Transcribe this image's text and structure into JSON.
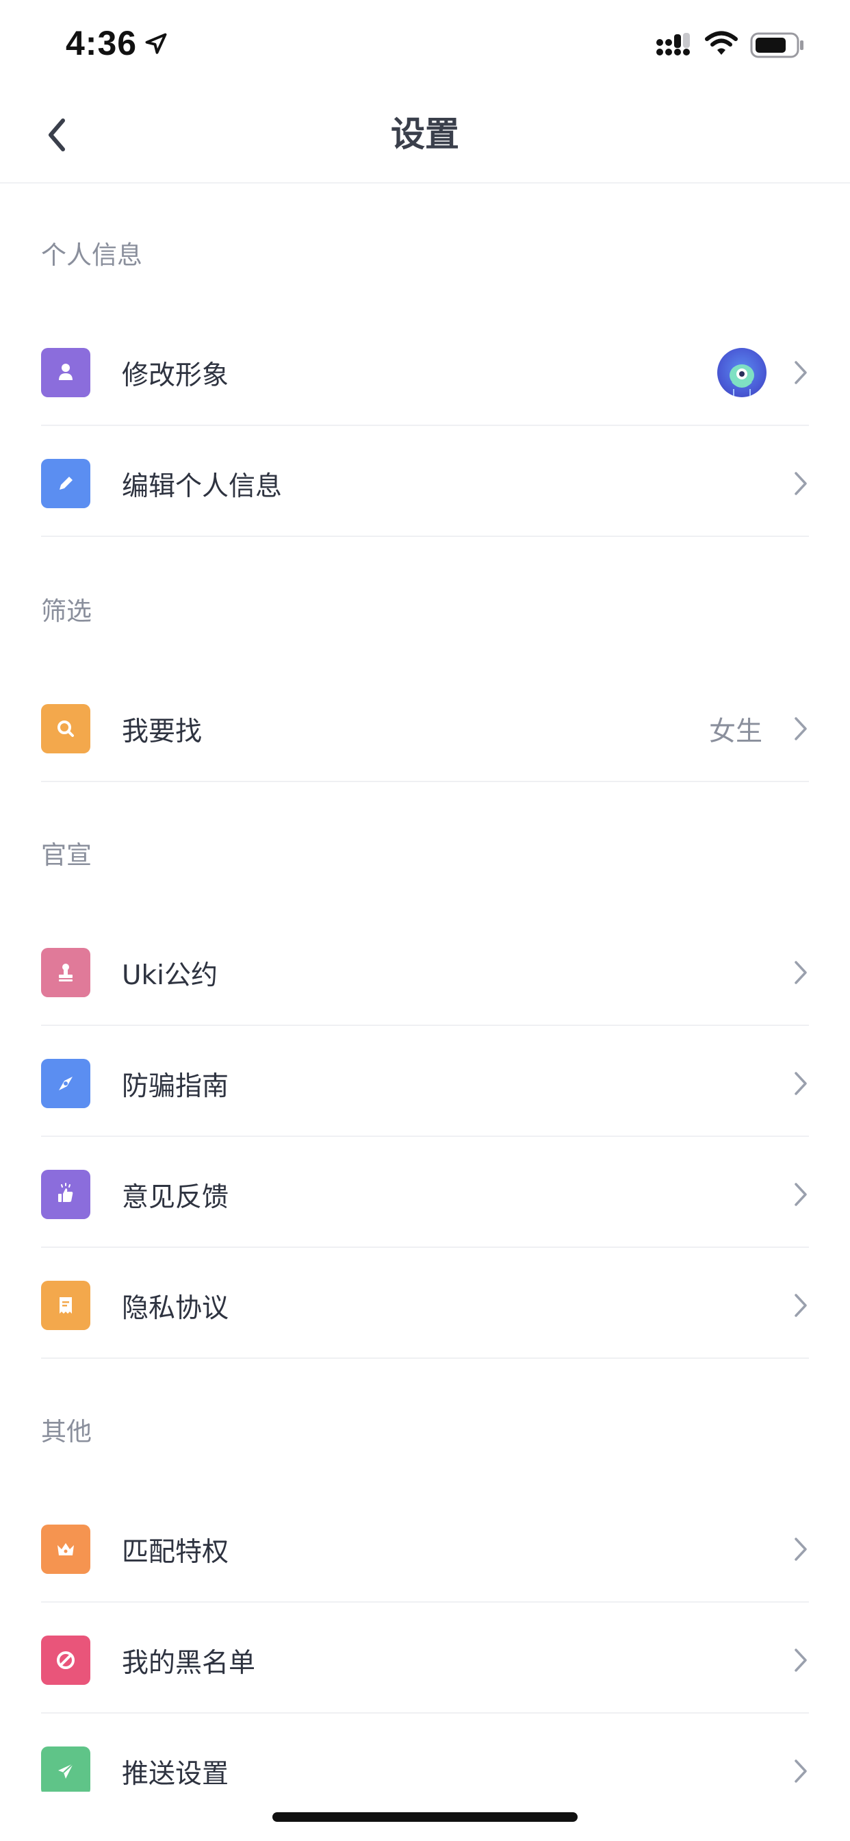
{
  "status_bar": {
    "time": "4:36"
  },
  "nav": {
    "title": "设置"
  },
  "colors": {
    "purple": "#8b6ddc",
    "blue": "#5b8ef1",
    "orange": "#f3a84c",
    "pink": "#e07a99",
    "orange_deep": "#f59450",
    "red": "#e9557a",
    "green": "#5fc488"
  },
  "sections": [
    {
      "title": "个人信息",
      "items": [
        {
          "label": "修改形象",
          "icon": "person-icon",
          "accessory": "avatar"
        },
        {
          "label": "编辑个人信息",
          "icon": "pencil-icon"
        }
      ]
    },
    {
      "title": "筛选",
      "items": [
        {
          "label": "我要找",
          "icon": "search-icon",
          "value": "女生"
        }
      ]
    },
    {
      "title": "官宣",
      "items": [
        {
          "label": "Uki公约",
          "icon": "stamp-icon"
        },
        {
          "label": "防骗指南",
          "icon": "compass-icon"
        },
        {
          "label": "意见反馈",
          "icon": "thumbs-up-icon"
        },
        {
          "label": "隐私协议",
          "icon": "document-icon"
        }
      ]
    },
    {
      "title": "其他",
      "items": [
        {
          "label": "匹配特权",
          "icon": "crown-icon"
        },
        {
          "label": "我的黑名单",
          "icon": "block-icon"
        },
        {
          "label": "推送设置",
          "icon": "paper-plane-icon"
        }
      ]
    }
  ]
}
